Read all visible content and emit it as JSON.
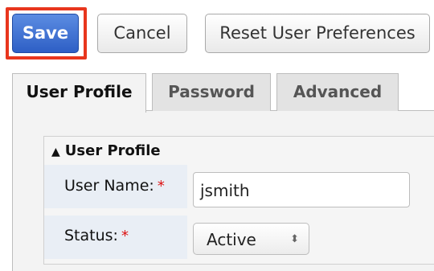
{
  "toolbar": {
    "save_label": "Save",
    "cancel_label": "Cancel",
    "reset_label": "Reset User Preferences",
    "highlight_color": "#e8361d"
  },
  "tabs": [
    {
      "label": "User Profile",
      "active": true
    },
    {
      "label": "Password",
      "active": false
    },
    {
      "label": "Advanced",
      "active": false
    }
  ],
  "section": {
    "title": "User Profile",
    "collapse_icon": "double-chevron-up-icon"
  },
  "fields": {
    "username": {
      "label": "User Name:",
      "required_mark": "*",
      "value": "jsmith"
    },
    "status": {
      "label": "Status:",
      "required_mark": "*",
      "value": "Active",
      "icon": "updown-arrows-icon"
    }
  }
}
